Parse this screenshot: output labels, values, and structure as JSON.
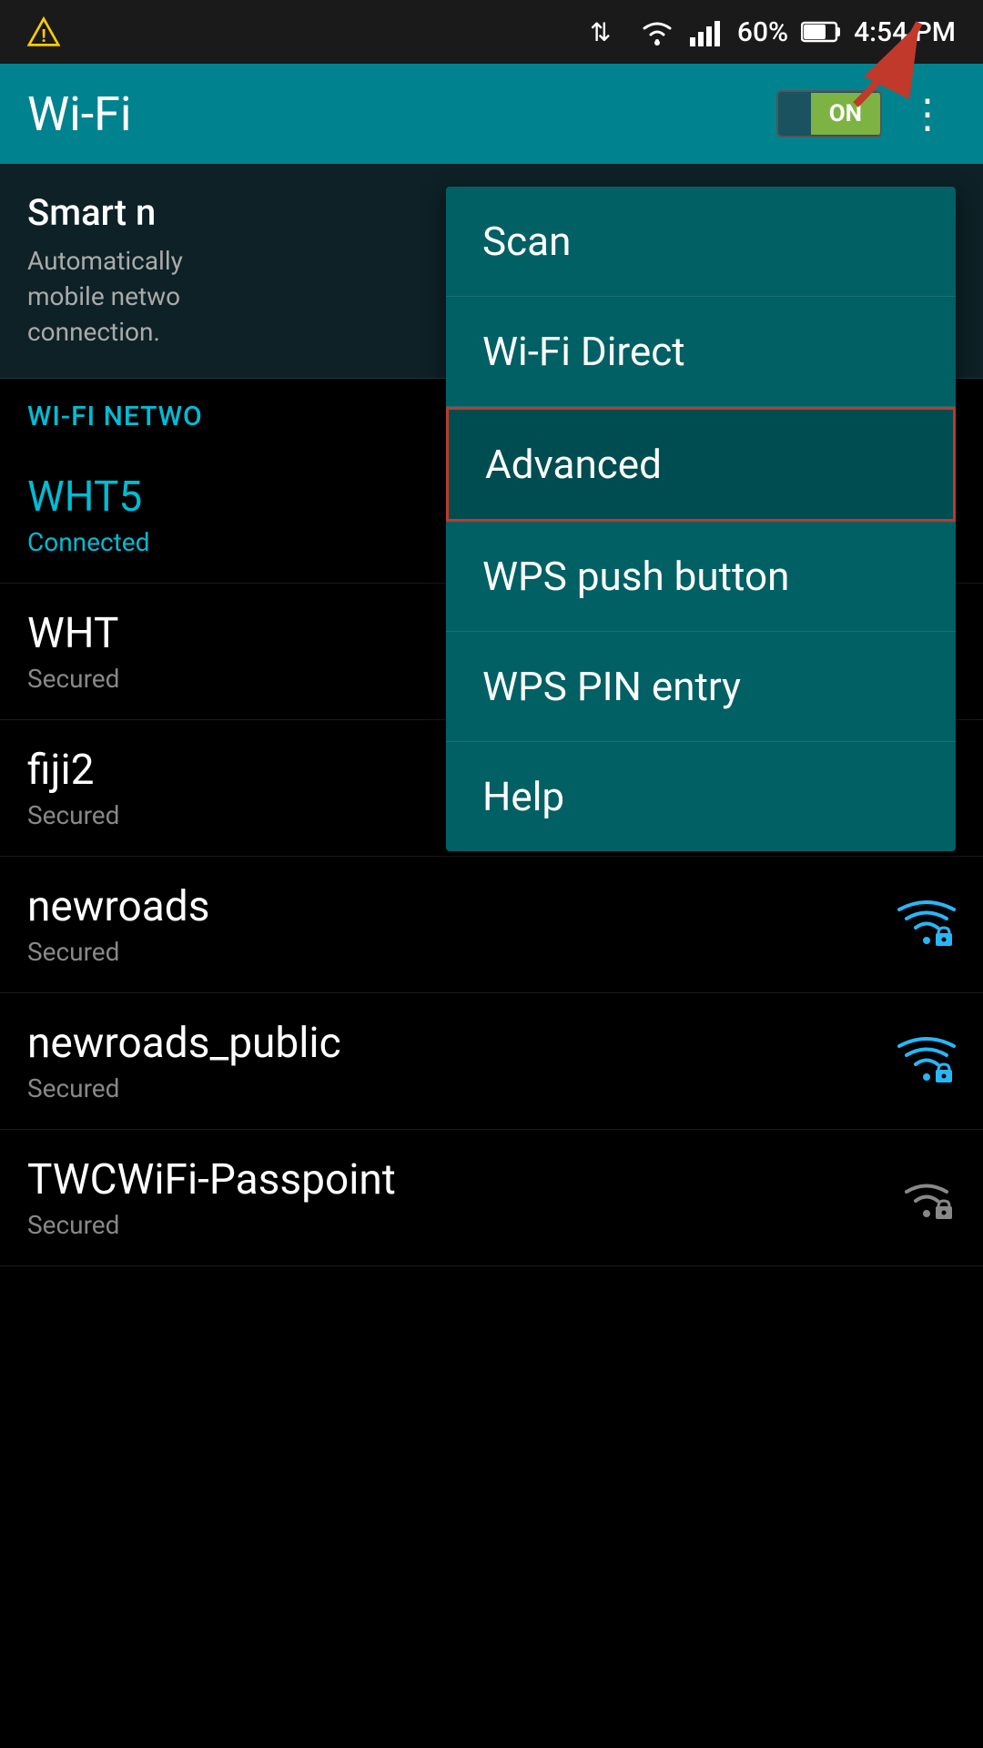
{
  "statusBar": {
    "battery": "60%",
    "time": "4:54 PM",
    "warningIcon": "⚠",
    "batteryIcon": "🔋"
  },
  "appBar": {
    "title": "Wi-Fi",
    "toggleOn": "ON",
    "toggleOff": "",
    "overflowIcon": "⋮"
  },
  "dropdown": {
    "items": [
      {
        "label": "Scan",
        "highlighted": false
      },
      {
        "label": "Wi-Fi Direct",
        "highlighted": false
      },
      {
        "label": "Advanced",
        "highlighted": true
      },
      {
        "label": "WPS push button",
        "highlighted": false
      },
      {
        "label": "WPS PIN entry",
        "highlighted": false
      },
      {
        "label": "Help",
        "highlighted": false
      }
    ]
  },
  "smartNetwork": {
    "title": "Smart n",
    "description": "Automatically\nmobile netwo\nconnection."
  },
  "wifiNetworksLabel": "Wi-Fi NETWO",
  "networks": [
    {
      "name": "WHT5",
      "status": "Connected",
      "connected": true,
      "secured": true,
      "signalStrength": "full"
    },
    {
      "name": "WHT",
      "status": "Secured",
      "connected": false,
      "secured": true,
      "signalStrength": "none"
    },
    {
      "name": "fiji2",
      "status": "Secured",
      "connected": false,
      "secured": true,
      "signalStrength": "full"
    },
    {
      "name": "newroads",
      "status": "Secured",
      "connected": false,
      "secured": true,
      "signalStrength": "full"
    },
    {
      "name": "newroads_public",
      "status": "Secured",
      "connected": false,
      "secured": true,
      "signalStrength": "full"
    },
    {
      "name": "TWCWiFi-Passpoint",
      "status": "Secured",
      "connected": false,
      "secured": true,
      "signalStrength": "medium"
    }
  ],
  "colors": {
    "teal": "#00838f",
    "darkTeal": "#006064",
    "accent": "#00bcd4",
    "red": "#c0392b",
    "green": "#7cb342"
  }
}
